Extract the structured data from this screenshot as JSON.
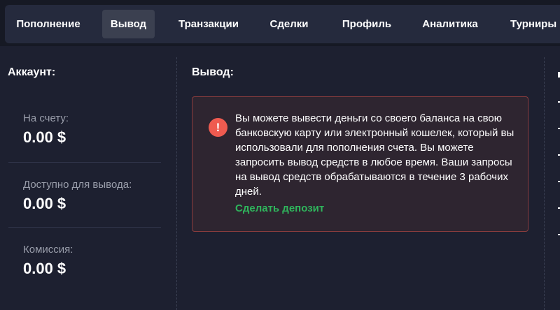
{
  "nav": {
    "tabs": [
      {
        "label": "Пополнение",
        "active": false
      },
      {
        "label": "Вывод",
        "active": true
      },
      {
        "label": "Транзакции",
        "active": false
      },
      {
        "label": "Сделки",
        "active": false
      },
      {
        "label": "Профиль",
        "active": false
      },
      {
        "label": "Аналитика",
        "active": false
      },
      {
        "label": "Турниры",
        "active": false
      }
    ]
  },
  "account": {
    "title": "Аккаунт:",
    "stats": [
      {
        "label": "На счету:",
        "value": "0.00 $"
      },
      {
        "label": "Доступно для вывода:",
        "value": "0.00 $"
      },
      {
        "label": "Комиссия:",
        "value": "0.00 $"
      }
    ]
  },
  "withdraw": {
    "title": "Вывод:",
    "alert": {
      "icon": "alert-icon",
      "text": "Вы можете вывести деньги со своего баланса на свою банковскую карту или электронный кошелек, который вы использовали для пополнения счета. Вы можете запросить вывод средств в любое время. Ваши запросы на вывод средств обрабатываются в течение 3 рабочих дней.",
      "link_label": "Сделать депозит"
    }
  },
  "colors": {
    "background": "#1d2030",
    "nav_bg": "#252a3d",
    "active_tab": "#3b4050",
    "alert_border": "#8a3c3d",
    "alert_icon": "#ef5b50",
    "link": "#2fb55c"
  }
}
